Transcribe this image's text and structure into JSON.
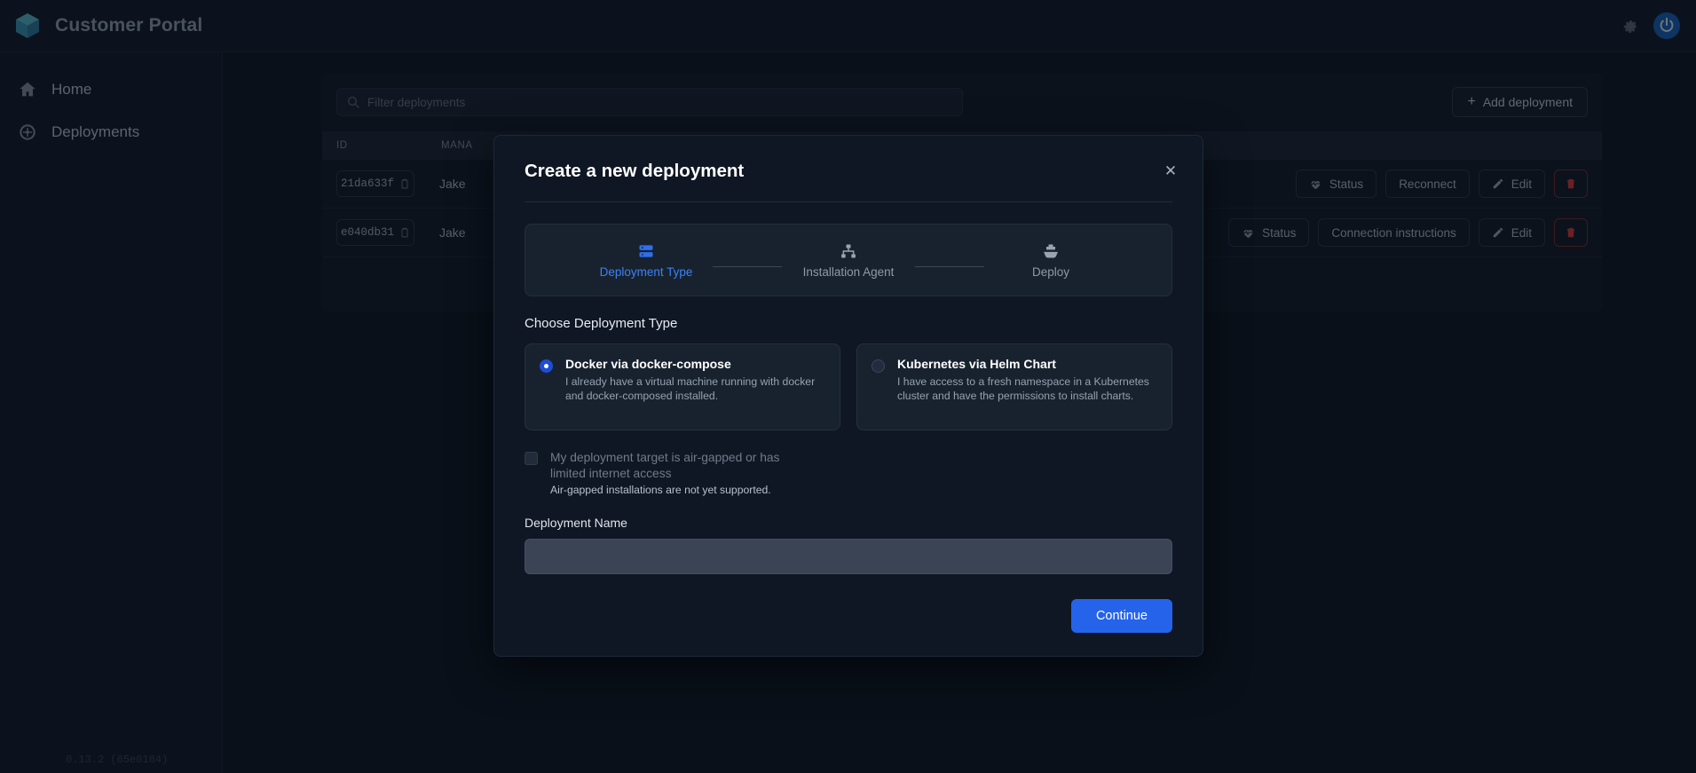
{
  "app": {
    "title": "Customer Portal",
    "logo_icon": "cube-icon",
    "version": "0.13.2 (65e0184)"
  },
  "topbar": {
    "settings_icon": "gear-icon",
    "avatar_icon": "user-avatar-icon"
  },
  "sidebar": {
    "items": [
      {
        "label": "Home",
        "icon": "home-icon"
      },
      {
        "label": "Deployments",
        "icon": "gauge-icon"
      }
    ]
  },
  "toolbar": {
    "search_placeholder": "Filter deployments",
    "search_value": "",
    "search_icon": "search-icon",
    "add_label": "Add deployment",
    "add_plus": "+"
  },
  "table": {
    "headers": {
      "id": "ID",
      "manager": "MANA"
    },
    "rows": [
      {
        "id": "21da633f",
        "manager": "Jake",
        "actions": [
          {
            "label": "Status",
            "icon": "pulse-icon"
          },
          {
            "label": "Reconnect",
            "icon": ""
          },
          {
            "label": "Edit",
            "icon": "pencil-icon"
          },
          {
            "label": "",
            "icon": "trash-icon"
          }
        ]
      },
      {
        "id": "e040db31",
        "manager": "Jake",
        "actions": [
          {
            "label": "Status",
            "icon": "pulse-icon"
          },
          {
            "label": "Connection instructions",
            "icon": ""
          },
          {
            "label": "Edit",
            "icon": "pencil-icon"
          },
          {
            "label": "",
            "icon": "trash-icon"
          }
        ]
      }
    ]
  },
  "modal": {
    "title": "Create a new deployment",
    "close_icon": "close-icon",
    "steps": [
      {
        "label": "Deployment Type",
        "icon": "server-icon",
        "active": true
      },
      {
        "label": "Installation Agent",
        "icon": "sitemap-icon",
        "active": false
      },
      {
        "label": "Deploy",
        "icon": "ship-icon",
        "active": false
      }
    ],
    "section_label": "Choose Deployment Type",
    "choices": [
      {
        "title": "Docker via docker-compose",
        "desc": "I already have a virtual machine running with docker and docker-composed installed.",
        "selected": true
      },
      {
        "title": "Kubernetes via Helm Chart",
        "desc": "I have access to a fresh namespace in a Kubernetes cluster and have the permissions to install charts.",
        "selected": false
      }
    ],
    "airgap": {
      "label": "My deployment target is air-gapped or has limited internet access",
      "note": "Air-gapped installations are not yet supported.",
      "checked": false
    },
    "name_field": {
      "label": "Deployment Name",
      "value": "",
      "placeholder": ""
    },
    "continue_label": "Continue"
  },
  "colors": {
    "accent_blue": "#2563eb",
    "step_active": "#3b82f6",
    "danger_red": "#e03b3b",
    "page_bg": "#0d1420",
    "panel_bg": "#111a27"
  }
}
